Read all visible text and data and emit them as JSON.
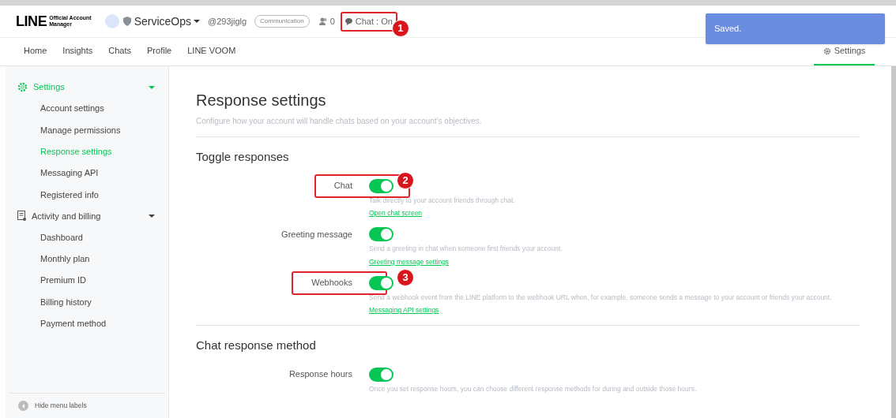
{
  "header": {
    "logo": "LINE",
    "logo_sub": [
      "Official Account",
      "Manager"
    ],
    "account": "ServiceOps",
    "account_id": "@293jiglg",
    "category": "Communication",
    "friends": "0",
    "chat_status": {
      "label": "Chat : On",
      "callout": "1"
    }
  },
  "toast": {
    "text": "Saved."
  },
  "tabs": [
    {
      "label": "Home",
      "selected": false
    },
    {
      "label": "Insights",
      "selected": false
    },
    {
      "label": "Chats",
      "selected": false
    },
    {
      "label": "Profile",
      "selected": false
    },
    {
      "label": "LINE VOOM",
      "selected": false
    }
  ],
  "settings_tab": {
    "label": "Settings",
    "selected": true
  },
  "sidebar": {
    "groups": [
      {
        "label": "Settings",
        "kind": "gear",
        "expanded": true,
        "children": [
          {
            "label": "Account settings",
            "selected": false
          },
          {
            "label": "Manage permissions",
            "selected": false
          },
          {
            "label": "Response settings",
            "selected": true
          },
          {
            "label": "Messaging API",
            "selected": false
          },
          {
            "label": "Registered info",
            "selected": false
          }
        ]
      },
      {
        "label": "Activity and billing",
        "kind": "doc",
        "expanded": true,
        "children": [
          {
            "label": "Dashboard",
            "selected": false
          },
          {
            "label": "Monthly plan",
            "selected": false
          },
          {
            "label": "Premium ID",
            "selected": false
          },
          {
            "label": "Billing history",
            "selected": false
          },
          {
            "label": "Payment method",
            "selected": false
          }
        ]
      }
    ],
    "footer": "Hide menu labels"
  },
  "page": {
    "title": "Response settings",
    "subtitle": "Configure how your account will handle chats based on your account's objectives.",
    "sections": [
      {
        "title": "Toggle responses",
        "rows": [
          {
            "label": "Chat",
            "on": true,
            "callout": "2",
            "description": "Talk directly to your account friends through chat.",
            "link": "Open chat screen"
          },
          {
            "label": "Greeting message",
            "on": true,
            "description": "Send a greeting in chat when someone first friends your account.",
            "link": "Greeting message settings"
          },
          {
            "label": "Webhooks",
            "on": true,
            "callout": "3",
            "description": "Send a webhook event from the LINE platform to the webhook URL when, for example, someone sends a message to your account or friends your account.",
            "link": "Messaging API settings"
          }
        ]
      },
      {
        "title": "Chat response method",
        "rows": [
          {
            "label": "Response hours",
            "on": true,
            "description": "Once you set response hours, you can choose different response methods for during and outside those hours."
          }
        ]
      }
    ]
  }
}
